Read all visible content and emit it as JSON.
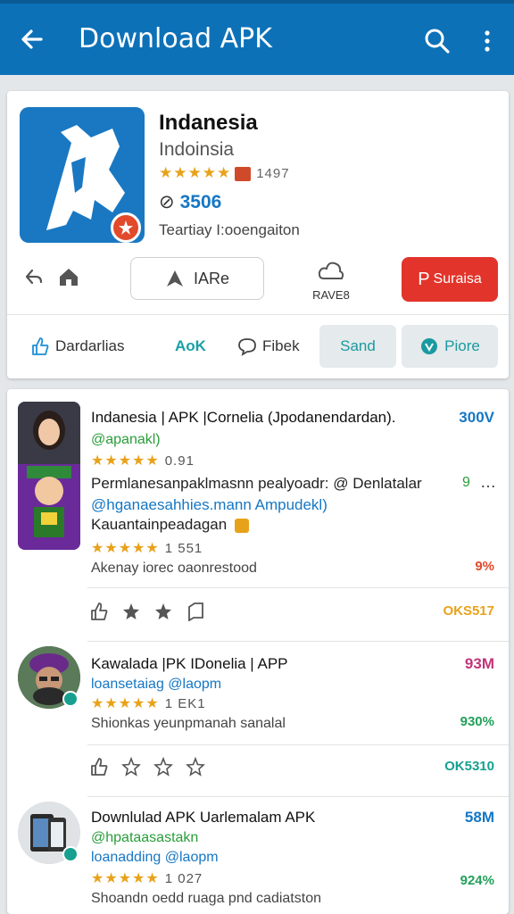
{
  "appbar": {
    "title": "Download APK"
  },
  "header": {
    "name": "Indanesia",
    "subtitle": "Indoinsia",
    "rating_stars": "★★★★★",
    "rating_count": "1497",
    "downloads": "3506",
    "developer": "Teartiay I:ooengaiton",
    "install_label": "IARe",
    "rave_label": "RAVE8",
    "primary_button_label": "Suraisa",
    "primary_button_glyph": "P",
    "actions": [
      {
        "label": "Dardarlias"
      },
      {
        "label": "AoK"
      },
      {
        "label": "Fibek"
      },
      {
        "label": "Sand"
      },
      {
        "label": "Piore"
      }
    ]
  },
  "items": [
    {
      "title": "Indanesia | APK |Cornelia (Jpodanendardan).",
      "size": "300V",
      "handle": "@apanakl)",
      "stars": "★★★★★",
      "score": "0.91",
      "body1": "Permlanesanpaklmasnn pealyoadr: @ Denlatalar",
      "body1_extra": "9",
      "body2": "@hganaesahhies.mann Ampudekl)",
      "body3": "Kauantainpeadagan",
      "stars2": "★★★★★",
      "score2": "1 551",
      "muted": "Akenay iorec oaonrestood",
      "tag": "9%",
      "action_tag": "OKS517"
    },
    {
      "title": "Kawalada |PK IDonelia | APP",
      "size": "93M",
      "handle": "loansetaiag @laopm",
      "stars": "★★★★★",
      "score": "1 EK1",
      "muted": "Shionkas yeunpmanah sanalal",
      "tag": "930%",
      "action_tag": "OK5310"
    },
    {
      "title": "Downlulad APK Uarlemalam APK",
      "size": "58M",
      "handle": "@hpataasastakn",
      "handle2": "loanadding @laopm",
      "stars": "★★★★★",
      "score": "1 027",
      "muted": "Shoandn oedd ruaga pnd cadiatston",
      "tag": "924%"
    }
  ],
  "colors": {
    "appbar": "#0d71b8",
    "accent": "#1677c4",
    "primary_button": "#e2342b",
    "star": "#e8a21a"
  }
}
